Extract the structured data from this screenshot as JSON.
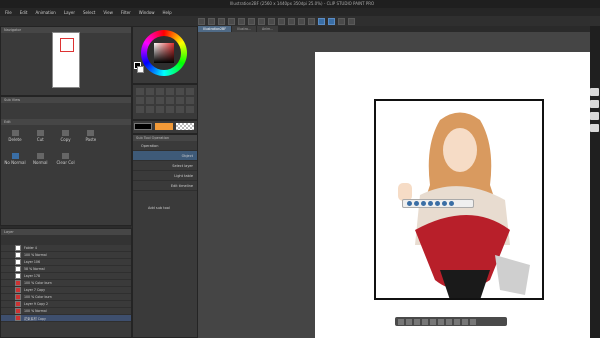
{
  "app": {
    "title": "Illustration2BF (2560 x 1440px 350dpi 25.0%) - CLIP STUDIO PAINT PRO"
  },
  "menu": [
    "File",
    "Edit",
    "Animation",
    "Layer",
    "Select",
    "View",
    "Filter",
    "Window",
    "Help"
  ],
  "navigator": {
    "title": "Navigator"
  },
  "subview": {
    "title": "Sub View"
  },
  "toolprops": {
    "title": "Sub Tool Operation",
    "rows": [
      {
        "label": "Operation",
        "value": ""
      },
      {
        "label": "",
        "value": "Object"
      },
      {
        "label": "",
        "value": "Select layer"
      },
      {
        "label": "",
        "value": "Light table"
      },
      {
        "label": "",
        "value": "Edit timeline"
      }
    ],
    "add": "Add sub tool"
  },
  "edit": {
    "header": "Edit",
    "ops": [
      "Delete",
      "Cut",
      "Copy",
      "Paste"
    ],
    "blend": [
      "No Normal",
      "Normal",
      "Clear Col"
    ]
  },
  "layers": {
    "header": "Layer",
    "rows": [
      {
        "name": "Folder 4",
        "thumb": "white"
      },
      {
        "name": "100 % Normal",
        "thumb": "white"
      },
      {
        "name": "Layer 106",
        "thumb": "white"
      },
      {
        "name": "58 % Normal",
        "thumb": "white"
      },
      {
        "name": "Layer 178",
        "thumb": "white"
      },
      {
        "name": "100 % Color burn",
        "thumb": "red"
      },
      {
        "name": "Layer 7 Copy",
        "thumb": "red"
      },
      {
        "name": "100 % Color burn",
        "thumb": "red"
      },
      {
        "name": "Layer 9 Copy 2",
        "thumb": "red"
      },
      {
        "name": "100 % Normal",
        "thumb": "red"
      },
      {
        "name": "花束素材 Copy",
        "thumb": "red",
        "selected": true
      }
    ]
  },
  "canvas": {
    "tabs": [
      "Illustration2BF",
      "Illustra...",
      "Anim..."
    ]
  },
  "colors": {
    "accent": "#3a6ea5",
    "orange": "#f29a38"
  }
}
